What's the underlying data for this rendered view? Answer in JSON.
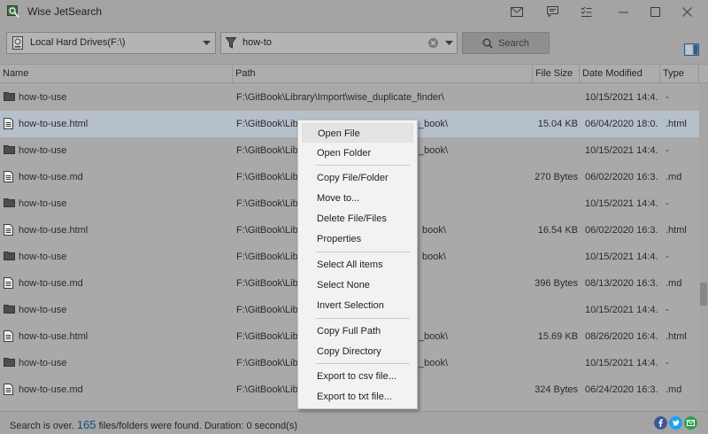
{
  "app": {
    "title": "Wise JetSearch"
  },
  "toolbar": {
    "drive_select": "Local Hard Drives(F:\\)",
    "query": "how-to",
    "search_label": "Search"
  },
  "table": {
    "columns": [
      "Name",
      "Path",
      "File Size",
      "Date Modified",
      "Type"
    ],
    "rows": [
      {
        "name": "how-to-use",
        "path": "F:\\GitBook\\Library\\Import\\wise_duplicate_finder\\",
        "size": "",
        "date": "10/15/2021 14:4...",
        "type": "-",
        "icon": "folder-icon"
      },
      {
        "name": "how-to-use.html",
        "path": "F:\\GitBook\\Library",
        "path_tail": "_book\\",
        "size": "15.04 KB",
        "date": "06/04/2020 18:0...",
        "type": ".html",
        "icon": "file-icon"
      },
      {
        "name": "how-to-use",
        "path": "F:\\GitBook\\Library",
        "path_tail": "_book\\",
        "size": "",
        "date": "10/15/2021 14:4...",
        "type": "-",
        "icon": "folder-icon"
      },
      {
        "name": "how-to-use.md",
        "path": "F:\\GitBook\\Library",
        "path_tail": "",
        "size": "270 Bytes",
        "date": "06/02/2020 16:3...",
        "type": ".md",
        "icon": "file-icon"
      },
      {
        "name": "how-to-use",
        "path": "F:\\GitBook\\Library",
        "path_tail": "",
        "size": "",
        "date": "10/15/2021 14:4...",
        "type": "-",
        "icon": "folder-icon"
      },
      {
        "name": "how-to-use.html",
        "path": "F:\\GitBook\\Library",
        "path_tail": "book\\",
        "size": "16.54 KB",
        "date": "06/02/2020 16:3...",
        "type": ".html",
        "icon": "file-icon"
      },
      {
        "name": "how-to-use",
        "path": "F:\\GitBook\\Library",
        "path_tail": "book\\",
        "size": "",
        "date": "10/15/2021 14:4...",
        "type": "-",
        "icon": "folder-icon"
      },
      {
        "name": "how-to-use.md",
        "path": "F:\\GitBook\\Library",
        "path_tail": "",
        "size": "396 Bytes",
        "date": "08/13/2020 16:3...",
        "type": ".md",
        "icon": "file-icon"
      },
      {
        "name": "how-to-use",
        "path": "F:\\GitBook\\Library",
        "path_tail": "",
        "size": "",
        "date": "10/15/2021 14:4...",
        "type": "-",
        "icon": "folder-icon"
      },
      {
        "name": "how-to-use.html",
        "path": "F:\\GitBook\\Library",
        "path_tail": "_book\\",
        "size": "15.69 KB",
        "date": "08/26/2020 16:4...",
        "type": ".html",
        "icon": "file-icon"
      },
      {
        "name": "how-to-use",
        "path": "F:\\GitBook\\Library",
        "path_tail": "_book\\",
        "size": "",
        "date": "10/15/2021 14:4...",
        "type": "-",
        "icon": "folder-icon"
      },
      {
        "name": "how-to-use.md",
        "path": "F:\\GitBook\\Library",
        "path_tail": "",
        "size": "324 Bytes",
        "date": "06/24/2020 16:3...",
        "type": ".md",
        "icon": "file-icon"
      }
    ]
  },
  "context_menu": {
    "items": [
      "Open File",
      "Open Folder",
      "Copy File/Folder",
      "Move to...",
      "Delete File/Files",
      "Properties",
      "Select All items",
      "Select None",
      "Invert Selection",
      "Copy Full Path",
      "Copy Directory",
      "Export to csv file...",
      "Export to txt file..."
    ]
  },
  "status": {
    "prefix": "Search is over.",
    "count": "165",
    "suffix": "files/folders were found. Duration: 0 second(s)"
  },
  "colors": {
    "facebook": "#3b5998",
    "twitter": "#1da1f2",
    "share": "#2e9e4f",
    "accent": "#0d4f7c"
  }
}
